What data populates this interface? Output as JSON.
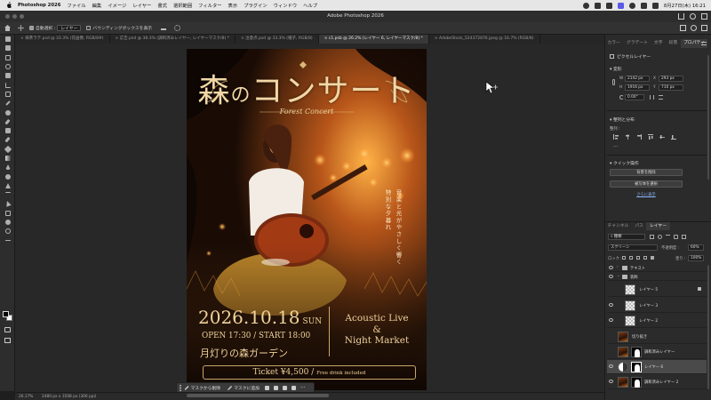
{
  "menubar": {
    "items": [
      "Photoshop 2026",
      "ファイル",
      "編集",
      "イメージ",
      "レイヤー",
      "書式",
      "選択範囲",
      "フィルター",
      "表示",
      "プラグイン",
      "ウィンドウ",
      "ヘルプ"
    ],
    "clock": "8月27日(木) 16:21"
  },
  "titlebar": {
    "title": "Adobe Photoshop 2026"
  },
  "options": {
    "auto_select_label": "自動選択 :",
    "auto_select_value": "レイヤー",
    "bounding_box_label": "バウンディングボックスを表示"
  },
  "tabs": [
    "抹茶ラテ.psd @ 33.3% (花画像, RGB/8#)",
    "広告.psd @ 38.3% (調和済みレイヤー, レイヤーマスク/8) *",
    "注意点.psd @ 33.3% (帽子, RGB/8)",
    "c1.psb @ 26.2% (レイヤー 6, レイヤーマスク/8) *",
    "AdobeStock_524372876.jpeg @ 16.7% (RGB/8)"
  ],
  "active_tab_index": 3,
  "poster": {
    "title_main": "森",
    "title_no": "の",
    "title_rest": "コンサート",
    "subtitle": "Forest Concert",
    "vertical_1": "音楽と光がやさしく響く",
    "vertical_2": "特別な夕暮れ",
    "date": "2026.10.18",
    "day": "SUN",
    "time": "OPEN 17:30 / START 18:00",
    "place": "月灯りの森ガーデン",
    "live_line1": "Acoustic Live",
    "live_line2": "&",
    "live_line3": "Night Market",
    "ticket": "Ticket ¥4,500",
    "ticket_sep": "/",
    "ticket_free": "Free drink included"
  },
  "taskbar": {
    "subtract_mask": "マスクから削除",
    "add_mask": "マスクに追加"
  },
  "status": {
    "zoom": "26.17%",
    "size": "2480 px x 3508 px (300 ppi)"
  },
  "panel": {
    "tabs": [
      "カラー",
      "グラデート",
      "文字",
      "段落",
      "プロパティ"
    ],
    "active_tab_index": 4,
    "pixel_layer_label": "ピクセルレイヤー",
    "transform_label": "変形",
    "w_label": "W",
    "w_value": "2142 px",
    "h_label": "H",
    "h_value": "1916 px",
    "x_label": "X",
    "x_value": "293 px",
    "y_label": "Y",
    "y_value": "710 px",
    "angle_value": "0.00°",
    "align_label": "整列と分布",
    "align_sub": "整列 :",
    "quick_label": "クイック操作",
    "remove_bg": "背景を削除",
    "select_subject": "被写体を選択",
    "more": "さらに表示"
  },
  "layers_panel": {
    "tabs": [
      "チャンネル",
      "パス",
      "レイヤー"
    ],
    "active_tab_index": 2,
    "filter_label": "種類",
    "blend_mode": "スクリーン",
    "opacity_label": "不透明度 :",
    "opacity_value": "60%",
    "lock_label": "ロック :",
    "fill_label": "塗り :",
    "fill_value": "100%",
    "layers": [
      {
        "name": "テキスト",
        "kind": "folder",
        "indent": 0,
        "visible": true
      },
      {
        "name": "装飾",
        "kind": "folder",
        "indent": 0,
        "visible": true
      },
      {
        "name": "レイヤー 5",
        "kind": "checker",
        "indent": 1,
        "visible": false,
        "locked": true
      },
      {
        "name": "レイヤー 3",
        "kind": "checker",
        "indent": 1,
        "visible": true
      },
      {
        "name": "レイヤー 2",
        "kind": "checker",
        "indent": 1,
        "visible": true
      },
      {
        "name": "切り抜き",
        "kind": "photo",
        "indent": 0,
        "visible": false
      },
      {
        "name": "調和済みレイヤー",
        "kind": "photo-mask",
        "indent": 0,
        "visible": false
      },
      {
        "name": "レイヤー 6",
        "kind": "adj-mask",
        "indent": 0,
        "visible": true,
        "selected": true
      },
      {
        "name": "調和済みレイヤー 2",
        "kind": "photo-mask",
        "indent": 0,
        "visible": true
      }
    ]
  },
  "colors": {
    "accent_gold": "#f0d29a",
    "selection": "#4a4a4a"
  }
}
